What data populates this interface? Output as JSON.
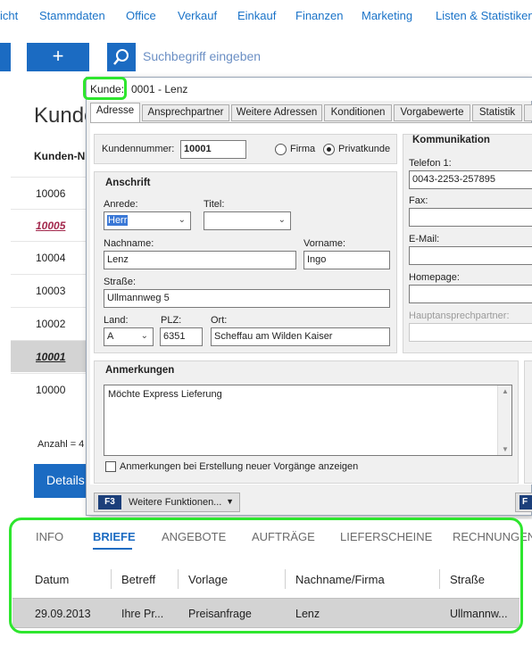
{
  "top_menu": [
    "icht",
    "Stammdaten",
    "Office",
    "Verkauf",
    "Einkauf",
    "Finanzen",
    "Marketing",
    "Listen & Statistiken"
  ],
  "toolbar": {
    "add_label": "+",
    "search_placeholder": "Suchbegriff eingeben"
  },
  "bg_list": {
    "title": "Kunde",
    "column_header": "Kunden-N",
    "rows": [
      "10006",
      "10005",
      "10004",
      "10003",
      "10002",
      "10001",
      "10000"
    ],
    "count_label": "Anzahl = 4",
    "details_label": "Details"
  },
  "dialog": {
    "title_label": "Kunde:",
    "title_value": "0001 - Lenz",
    "tabs": [
      "Adresse",
      "Ansprechpartner",
      "Weitere Adressen",
      "Konditionen",
      "Vorgabewerte",
      "Statistik"
    ],
    "kundennummer_label": "Kundennummer:",
    "kundennummer_value": "10001",
    "firma_label": "Firma",
    "privatkunde_label": "Privatkunde",
    "anschrift_title": "Anschrift",
    "anrede_label": "Anrede:",
    "anrede_value": "Herr",
    "titel_label": "Titel:",
    "titel_value": "",
    "nachname_label": "Nachname:",
    "nachname_value": "Lenz",
    "vorname_label": "Vorname:",
    "vorname_value": "Ingo",
    "strasse_label": "Straße:",
    "strasse_value": "Ullmannweg 5",
    "land_label": "Land:",
    "land_value": "A",
    "plz_label": "PLZ:",
    "plz_value": "6351",
    "ort_label": "Ort:",
    "ort_value": "Scheffau am Wilden Kaiser",
    "kommunikation_title": "Kommunikation",
    "telefon_label": "Telefon 1:",
    "telefon_value": "0043-2253-257895",
    "fax_label": "Fax:",
    "email_label": "E-Mail:",
    "homepage_label": "Homepage:",
    "hauptansprechpartner_label": "Hauptansprechpartner:",
    "anmerkungen_title": "Anmerkungen",
    "anmerkungen_value": "Möchte Express Lieferung",
    "anmerkungen_checkbox_label": "Anmerkungen bei Erstellung neuer Vorgänge anzeigen",
    "fn_key": "F3",
    "fn_label": "Weitere Funktionen...",
    "fn_key2": "F"
  },
  "bottom": {
    "tabs": [
      "INFO",
      "BRIEFE",
      "ANGEBOTE",
      "AUFTRÄGE",
      "LIEFERSCHEINE",
      "RECHNUNGEN"
    ],
    "columns": [
      "Datum",
      "Betreff",
      "Vorlage",
      "Nachname/Firma",
      "Straße"
    ],
    "row": [
      "29.09.2013",
      "Ihre Pr...",
      "Preisanfrage",
      "Lenz",
      "Ullmannw..."
    ]
  }
}
